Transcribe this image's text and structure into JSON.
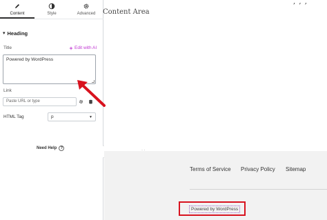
{
  "tabs": [
    {
      "label": "Content",
      "icon": "pencil-icon",
      "active": true
    },
    {
      "label": "Style",
      "icon": "contrast-icon",
      "active": false
    },
    {
      "label": "Advanced",
      "icon": "gear-icon",
      "active": false
    }
  ],
  "section": {
    "title": "Heading"
  },
  "title_field": {
    "label": "Title",
    "ai_label": "Edit with AI",
    "value": "Powered by WordPress"
  },
  "link_field": {
    "label": "Link",
    "placeholder": "Paste URL or type"
  },
  "html_tag": {
    "label": "HTML Tag",
    "value": "p"
  },
  "help": {
    "label": "Need Help"
  },
  "preview": {
    "content_area": "Content Area",
    "footer_links": [
      "Terms of Service",
      "Privacy Policy",
      "Sitemap"
    ],
    "powered_text": "Powered by WordPress"
  },
  "colors": {
    "ai_accent": "#c036d2",
    "highlight_red": "#d8121e",
    "footer_bg": "#f2f2f2"
  }
}
